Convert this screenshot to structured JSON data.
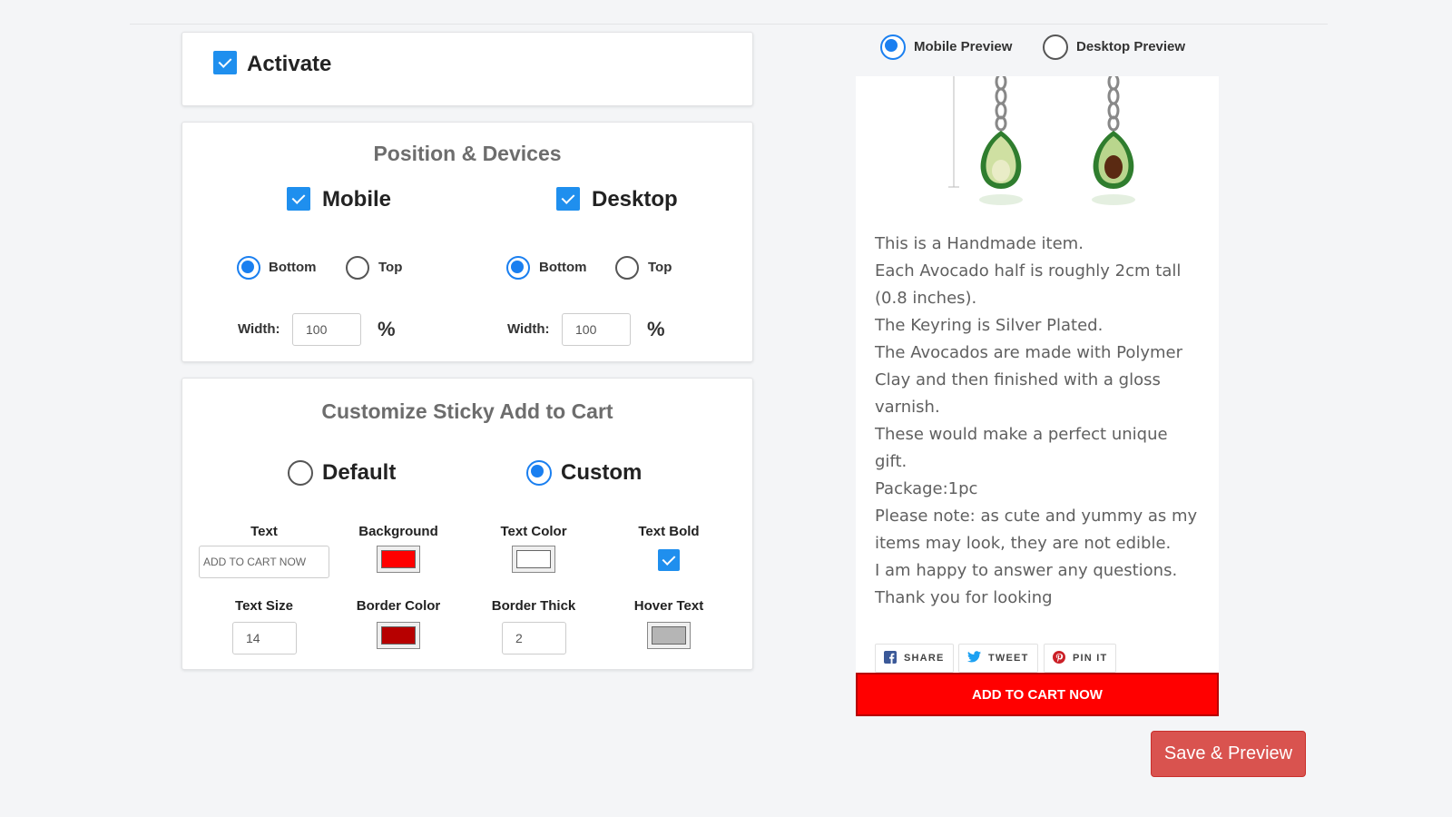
{
  "activate": {
    "label": "Activate",
    "checked": true
  },
  "position": {
    "title": "Position & Devices",
    "mobile": {
      "label": "Mobile",
      "checked": true,
      "bottom_label": "Bottom",
      "top_label": "Top",
      "selected": "Bottom",
      "width_label": "Width:",
      "width_value": "100",
      "unit": "%"
    },
    "desktop": {
      "label": "Desktop",
      "checked": true,
      "bottom_label": "Bottom",
      "top_label": "Top",
      "selected": "Bottom",
      "width_label": "Width:",
      "width_value": "100",
      "unit": "%"
    }
  },
  "customize": {
    "title": "Customize Sticky Add to Cart",
    "default_label": "Default",
    "custom_label": "Custom",
    "selected": "Custom",
    "text_label": "Text",
    "text_value": "ADD TO CART NOW",
    "background_label": "Background",
    "background_color": "#ff0000",
    "text_color_label": "Text Color",
    "text_color": "#ffffff",
    "text_bold_label": "Text Bold",
    "text_bold": true,
    "text_size_label": "Text Size",
    "text_size_value": "14",
    "border_color_label": "Border Color",
    "border_color": "#b70000",
    "border_thick_label": "Border Thick",
    "border_thick_value": "2",
    "hover_text_label": "Hover Text",
    "hover_text_color": "#b5b5b5"
  },
  "preview": {
    "mobile_label": "Mobile Preview",
    "desktop_label": "Desktop Preview",
    "selected": "Mobile Preview",
    "description": [
      "This is a Handmade item.",
      "Each Avocado half is roughly 2cm tall (0.8 inches).",
      "The Keyring is Silver Plated.",
      "The Avocados are made with Polymer Clay and then finished with a gloss varnish.",
      "These would make a perfect unique gift.",
      "Package:1pc",
      "Please note: as cute and yummy as my items may look, they are not edible.",
      "I am happy to answer any questions.",
      "Thank you for looking"
    ],
    "share": {
      "facebook": "SHARE",
      "twitter": "TWEET",
      "pinterest": "PIN IT"
    },
    "sticky_button": "ADD TO CART NOW"
  },
  "save_button": "Save & Preview"
}
